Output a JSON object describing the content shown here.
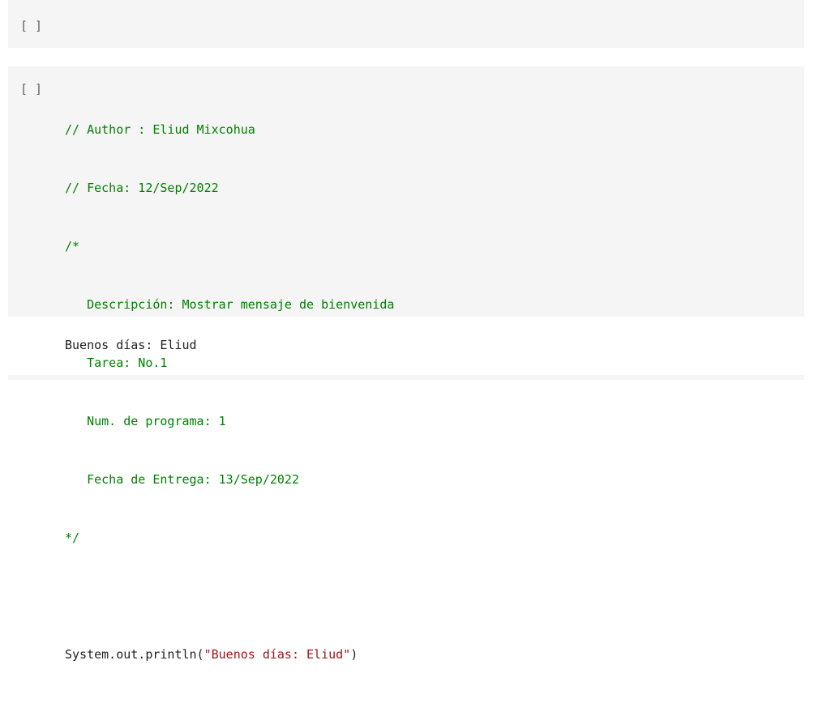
{
  "cells": [
    {
      "run_label": "[ ]"
    },
    {
      "run_label": "[ ]",
      "code": {
        "comment_lines": [
          "// Author : Eliud Mixcohua",
          "// Fecha: 12/Sep/2022",
          "/*",
          "   Descripción: Mostrar mensaje de bienvenida",
          "   Tarea: No.1",
          "   Num. de programa: 1",
          "   Fecha de Entrega: 13/Sep/2022",
          "*/"
        ],
        "println_prefix": "System.out.println(",
        "println_string": "\"Buenos días: Eliud\"",
        "println_suffix": ")"
      },
      "output": "Buenos días: Eliud"
    }
  ],
  "colors": {
    "cell_background": "#f5f5f5",
    "comment": "#008000",
    "string": "#a31515",
    "plain": "#212121"
  }
}
